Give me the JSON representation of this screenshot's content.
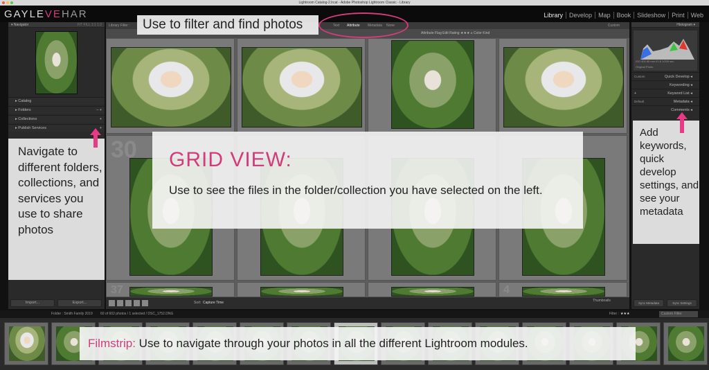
{
  "window_title": "Lightroom Catalog-2.lrcat - Adobe Photoshop Lightroom Classic - Library",
  "logo": {
    "part1": "GAYLE",
    "part2": "VE",
    "part3": "HAR"
  },
  "modules": [
    "Library",
    "Develop",
    "Map",
    "Book",
    "Slideshow",
    "Print",
    "Web"
  ],
  "left_panel": {
    "navigator": "Navigator",
    "nav_zoom": "FIT FILL 1:1 1:2",
    "sections": [
      "Catalog",
      "Folders",
      "Collections",
      "Publish Services"
    ],
    "import": "Import...",
    "export": "Export..."
  },
  "filter": {
    "label": "Library Filter :",
    "tabs": [
      "Text",
      "Attribute",
      "Metadata",
      "None"
    ],
    "preset": "Custom",
    "attribute_row": "Attribute   Flag   Edit   Rating ★★★ ≥   Color   Kind"
  },
  "grid": {
    "cell_numbers": [
      "",
      "",
      "",
      "",
      "30",
      "",
      "",
      "",
      "37",
      "",
      "",
      "4"
    ]
  },
  "toolbar": {
    "sort_label": "Sort:",
    "sort_value": "Capture Time",
    "thumbnails": "Thumbnails"
  },
  "right_panel": {
    "histogram": "Histogram",
    "hist_info": "ISO 400   85 mm   f/1.8   1/200 sec",
    "original_photo": "Original Photo",
    "saved_preset": "Custom",
    "quick_develop": "Quick Develop",
    "keywording": "Keywording",
    "keyword_list": "Keyword List",
    "metadata_preset": "Default",
    "metadata": "Metadata",
    "comments": "Comments",
    "sync_metadata": "Sync Metadata",
    "sync_settings": "Sync Settings"
  },
  "filmstrip_bar": {
    "path": "Folder : Smith Family 2019",
    "count": "60 of 602 photos / 1 selected / DSC_1752.DNG",
    "filter_label": "Filter :",
    "filter_value": "Custom Filter"
  },
  "annotations": {
    "filter": "Use to filter and find photos",
    "grid_title": "GRID VIEW:",
    "grid_body": "Use to see the files in the folder/collection you have selected on the left.",
    "left": "Navigate to different folders, collections, and services you use to share photos",
    "right": "Add keywords, quick develop settings, and see your metadata",
    "film_key": "Filmstrip:",
    "film_body": " Use to navigate through your photos in all the different Lightroom modules."
  },
  "colors": {
    "accent": "#d33c7a",
    "arrow": "#e63a86"
  }
}
